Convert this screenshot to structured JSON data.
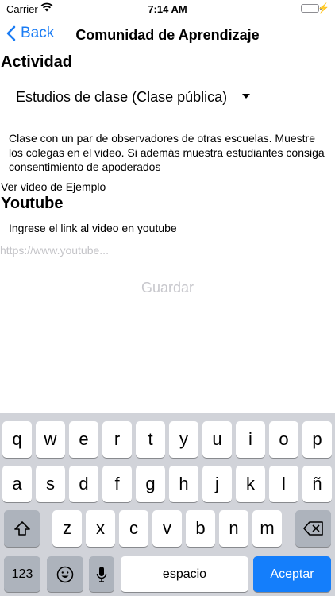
{
  "status_bar": {
    "carrier": "Carrier",
    "time": "7:14 AM"
  },
  "nav": {
    "back_label": "Back",
    "title": "Comunidad de Aprendizaje"
  },
  "activity": {
    "heading": "Actividad",
    "selected": "Estudios de clase (Clase pública)",
    "description": "Clase con un par de observadores de otras escuelas. Muestre los colegas en el video. Si además muestra estudiantes consiga consentimiento de apoderados",
    "example_link": "Ver video de Ejemplo"
  },
  "youtube": {
    "heading": "Youtube",
    "prompt": "Ingrese el link al video en youtube",
    "placeholder": "https://www.youtube...",
    "value": ""
  },
  "save_label": "Guardar",
  "keyboard": {
    "row1": [
      "q",
      "w",
      "e",
      "r",
      "t",
      "y",
      "u",
      "i",
      "o",
      "p"
    ],
    "row2": [
      "a",
      "s",
      "d",
      "f",
      "g",
      "h",
      "j",
      "k",
      "l",
      "ñ"
    ],
    "row3": [
      "z",
      "x",
      "c",
      "v",
      "b",
      "n",
      "m"
    ],
    "numbers_label": "123",
    "space_label": "espacio",
    "return_label": "Aceptar"
  }
}
